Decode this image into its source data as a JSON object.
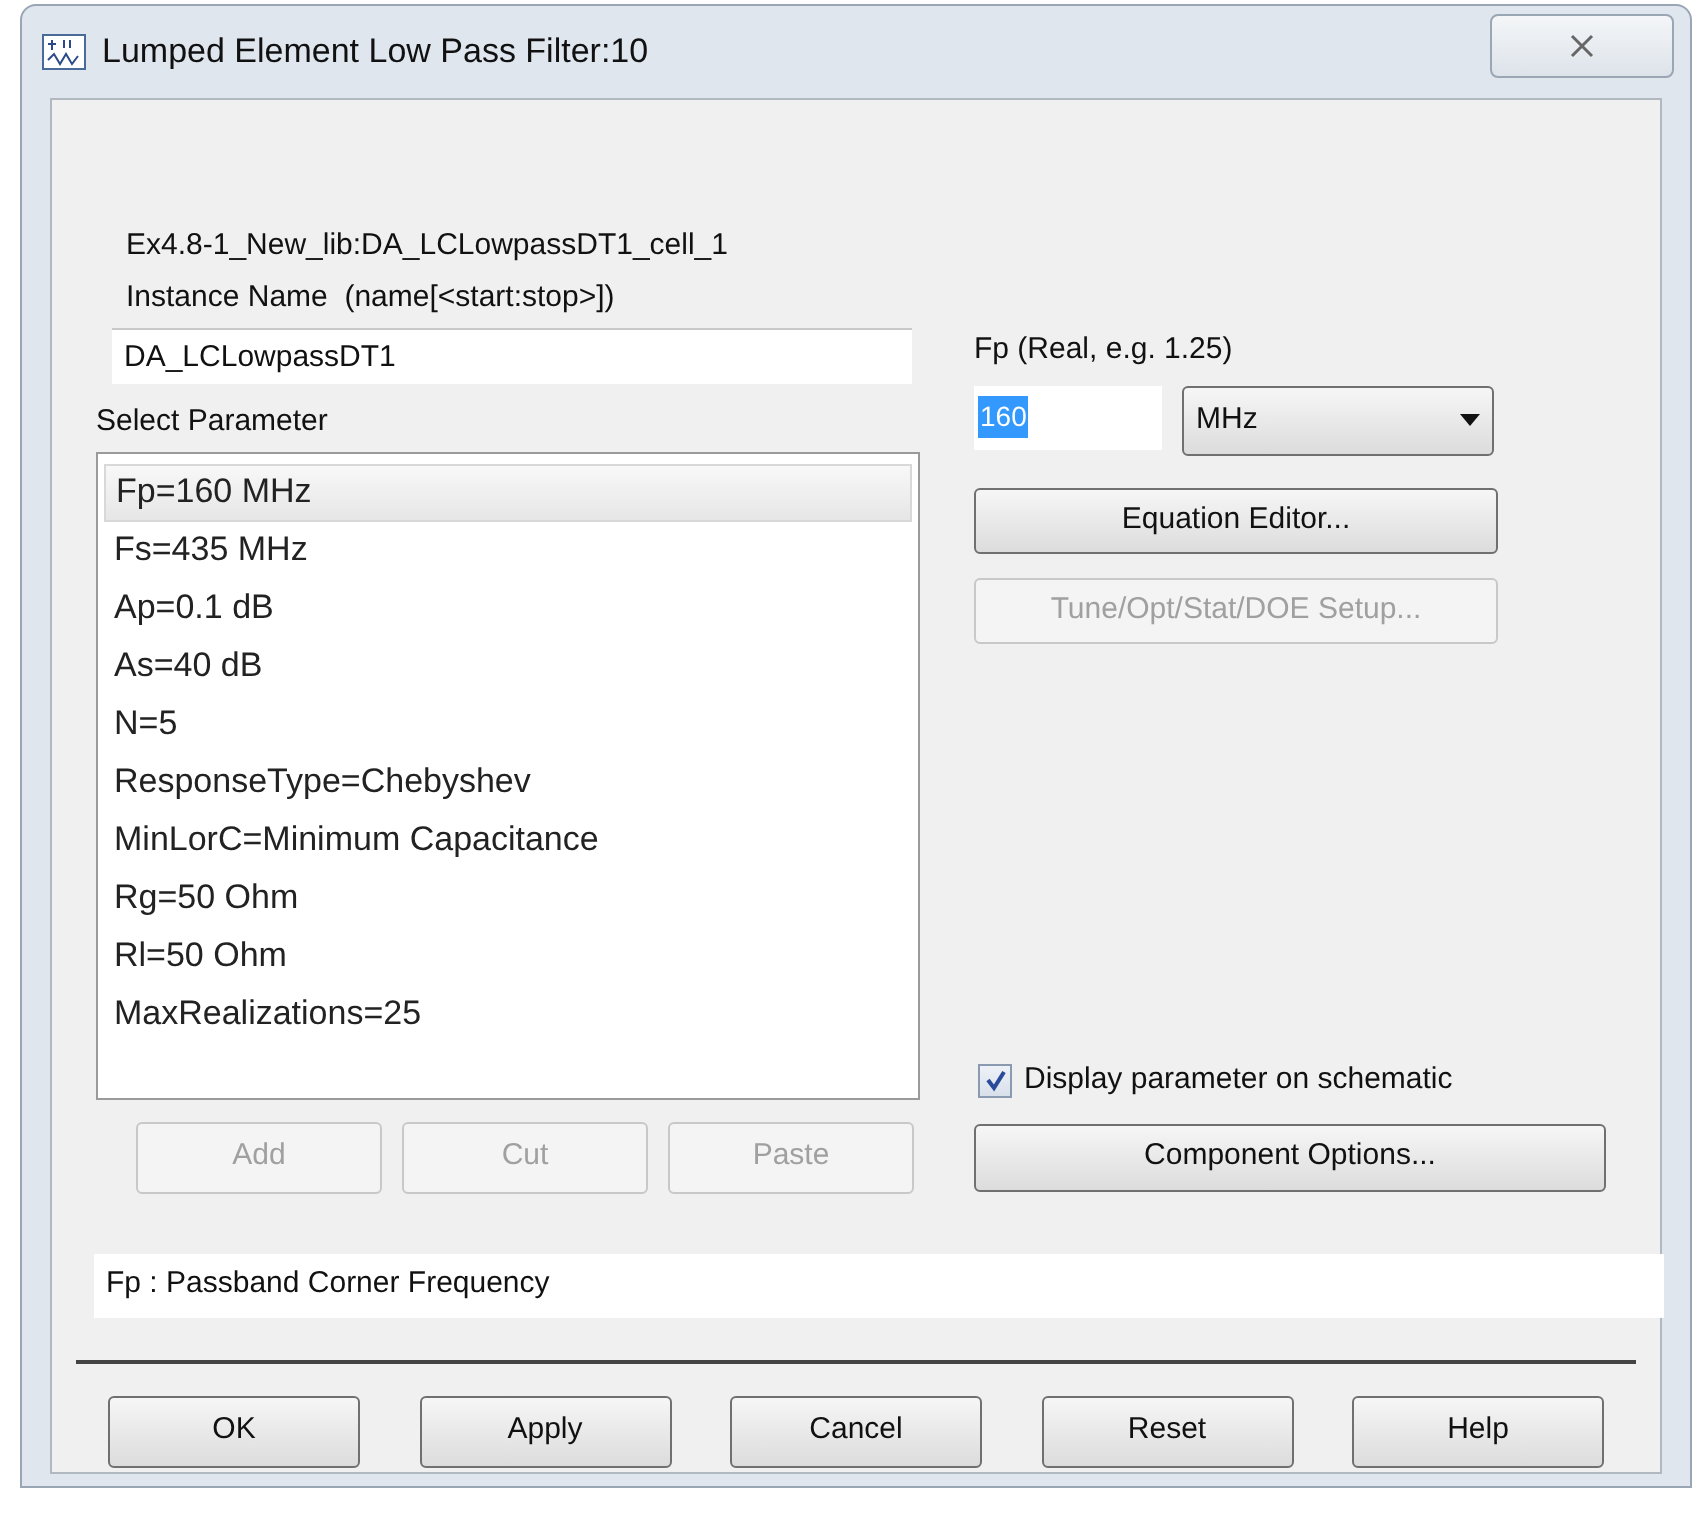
{
  "window": {
    "title": "Lumped Element Low Pass Filter:10"
  },
  "cell_path": "Ex4.8-1_New_lib:DA_LCLowpassDT1_cell_1",
  "instance_name": {
    "label": "Instance Name  (name[<start:stop>])",
    "value": "DA_LCLowpassDT1"
  },
  "parameter_list": {
    "label": "Select Parameter",
    "items": [
      {
        "text": "Fp=160 MHz",
        "selected": true
      },
      {
        "text": "Fs=435 MHz",
        "selected": false
      },
      {
        "text": "Ap=0.1 dB",
        "selected": false
      },
      {
        "text": "As=40 dB",
        "selected": false
      },
      {
        "text": "N=5",
        "selected": false
      },
      {
        "text": "ResponseType=Chebyshev",
        "selected": false
      },
      {
        "text": "MinLorC=Minimum Capacitance",
        "selected": false
      },
      {
        "text": "Rg=50 Ohm",
        "selected": false
      },
      {
        "text": "Rl=50 Ohm",
        "selected": false
      },
      {
        "text": "MaxRealizations=25",
        "selected": false
      }
    ]
  },
  "list_buttons": [
    {
      "label": "Add",
      "disabled": true
    },
    {
      "label": "Cut",
      "disabled": true
    },
    {
      "label": "Paste",
      "disabled": true
    }
  ],
  "value_field": {
    "label": "Fp (Real, e.g. 1.25)",
    "value": "160",
    "unit": "MHz"
  },
  "side_buttons": [
    {
      "label": "Equation Editor...",
      "disabled": false
    },
    {
      "label": "Tune/Opt/Stat/DOE Setup...",
      "disabled": true
    }
  ],
  "display_on_schematic": {
    "label": "Display parameter on schematic",
    "checked": true
  },
  "component_options": {
    "label": "Component Options...",
    "disabled": false
  },
  "description": "Fp : Passband Corner Frequency",
  "dialog_buttons": [
    {
      "label": "OK"
    },
    {
      "label": "Apply"
    },
    {
      "label": "Cancel"
    },
    {
      "label": "Reset"
    },
    {
      "label": "Help"
    }
  ]
}
